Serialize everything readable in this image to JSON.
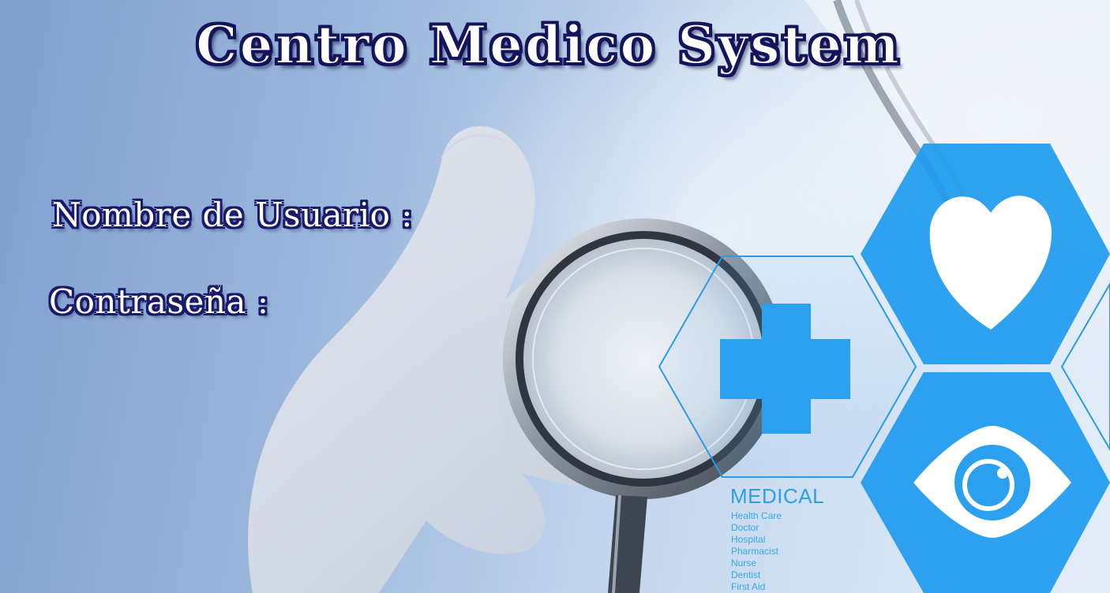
{
  "app": {
    "title": "Centro Medico System"
  },
  "login_form": {
    "username_label": "Nombre de Usuario :",
    "password_label": "Contraseña :"
  },
  "medical_graphic": {
    "heading": "MEDICAL",
    "items": [
      "Health Care",
      "Doctor",
      "Hospital",
      "Pharmacist",
      "Nurse",
      "Dentist",
      "First Aid"
    ],
    "icons": [
      "medical-cross-icon",
      "heart-icon",
      "eye-icon",
      "stethoscope-icon"
    ]
  },
  "colors": {
    "title_text": "#ffffff",
    "title_outline": "#14145a",
    "label_outline": "#1a1a6b",
    "accent_blue": "#2196f3",
    "background_blue": "#9ab6dc"
  }
}
